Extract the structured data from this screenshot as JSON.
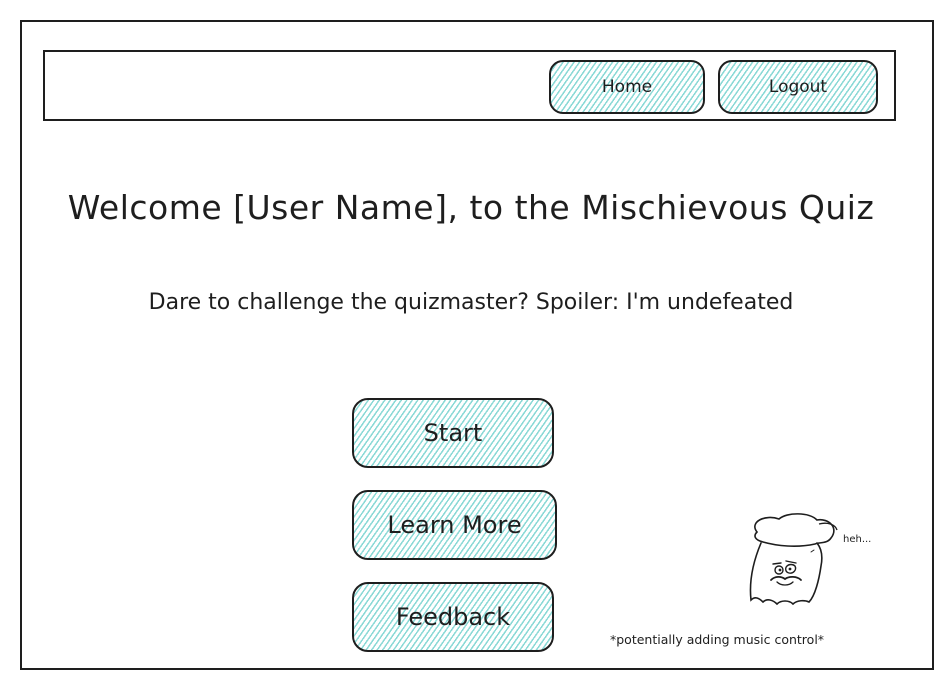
{
  "nav": {
    "home_label": "Home",
    "logout_label": "Logout"
  },
  "main": {
    "title": "Welcome [User Name], to the Mischievous Quiz",
    "subtitle": "Dare to challenge the quizmaster? Spoiler: I'm undefeated",
    "buttons": {
      "start": "Start",
      "learn_more": "Learn More",
      "feedback": "Feedback"
    }
  },
  "mascot": {
    "icon": "quizmaster-ghost-icon",
    "speech": "heh..."
  },
  "note": "*potentially adding music control*",
  "colors": {
    "hatch": "#8ad9d6",
    "stroke": "#1e1e1e",
    "background": "#ffffff"
  }
}
